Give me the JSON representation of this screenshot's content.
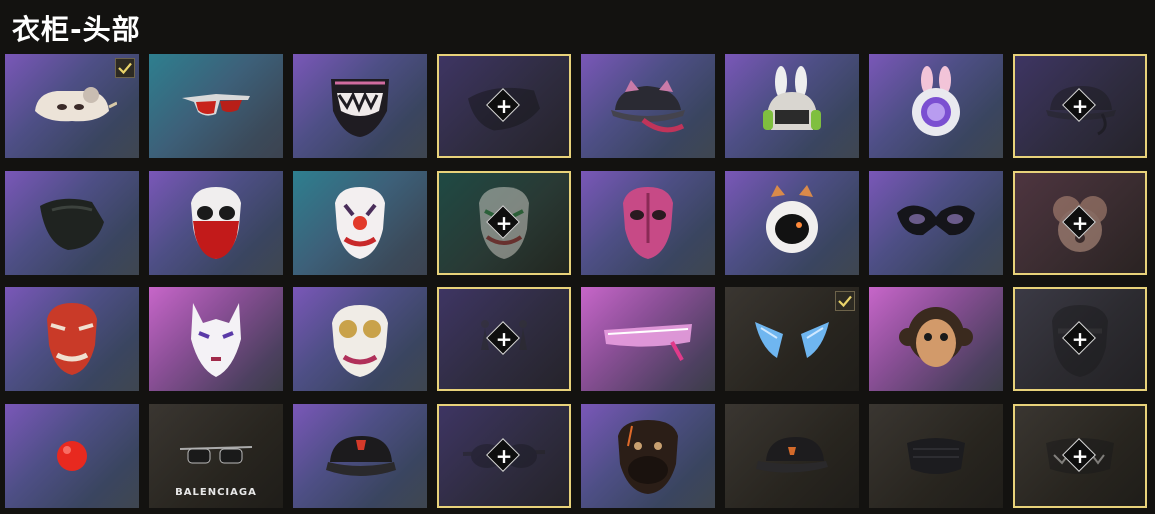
{
  "header": {
    "title": "衣柜-头部"
  },
  "accent_color": "#e8d27a",
  "check_color": "#e9d36a",
  "plus_symbol": "+",
  "items": [
    {
      "icon": "cat-visor-icon",
      "bg": "purple",
      "state": "selected"
    },
    {
      "icon": "sunglasses-icon",
      "bg": "teal",
      "state": "normal"
    },
    {
      "icon": "teeth-mask-icon",
      "bg": "purple",
      "state": "normal"
    },
    {
      "icon": "bandana-icon",
      "bg": "dim-purple",
      "state": "locked"
    },
    {
      "icon": "cat-ear-cap-icon",
      "bg": "purple",
      "state": "normal"
    },
    {
      "icon": "bunny-headphones-icon",
      "bg": "purple",
      "state": "normal"
    },
    {
      "icon": "bunny-astronaut-icon",
      "bg": "purple",
      "state": "normal"
    },
    {
      "icon": "headset-cap-icon",
      "bg": "dim-purple",
      "state": "locked"
    },
    {
      "icon": "face-scarf-icon",
      "bg": "purple",
      "state": "normal"
    },
    {
      "icon": "red-skull-mask-icon",
      "bg": "purple",
      "state": "normal"
    },
    {
      "icon": "clown-mask-icon",
      "bg": "teal",
      "state": "normal"
    },
    {
      "icon": "joker-mask-icon",
      "bg": "dim-teal",
      "state": "locked"
    },
    {
      "icon": "pink-face-mask-icon",
      "bg": "purple",
      "state": "normal"
    },
    {
      "icon": "cat-astronaut-icon",
      "bg": "purple",
      "state": "normal"
    },
    {
      "icon": "masquerade-mask-icon",
      "bg": "purple",
      "state": "normal"
    },
    {
      "icon": "poodle-mask-icon",
      "bg": "dim-rose",
      "state": "locked"
    },
    {
      "icon": "oni-mask-icon",
      "bg": "purple",
      "state": "normal"
    },
    {
      "icon": "kitsune-mask-icon",
      "bg": "pink",
      "state": "normal"
    },
    {
      "icon": "steampunk-mask-icon",
      "bg": "purple",
      "state": "normal"
    },
    {
      "icon": "earrings-icon",
      "bg": "dim-purple",
      "state": "locked"
    },
    {
      "icon": "cyber-visor-icon",
      "bg": "pink",
      "state": "normal"
    },
    {
      "icon": "crystal-ears-icon",
      "bg": "dark",
      "state": "selected"
    },
    {
      "icon": "monkey-mask-icon",
      "bg": "pink",
      "state": "normal"
    },
    {
      "icon": "tactical-mask-icon",
      "bg": "dim-gray",
      "state": "locked"
    },
    {
      "icon": "clown-nose-icon",
      "bg": "purple",
      "state": "normal"
    },
    {
      "icon": "balenciaga-glasses-icon",
      "bg": "dark",
      "state": "normal",
      "brand": "BALENCIAGA"
    },
    {
      "icon": "black-cap-icon",
      "bg": "purple",
      "state": "normal"
    },
    {
      "icon": "goggles-icon",
      "bg": "dim-purple",
      "state": "locked"
    },
    {
      "icon": "bulldog-mask-icon",
      "bg": "purple",
      "state": "normal"
    },
    {
      "icon": "baseball-cap-icon",
      "bg": "dark",
      "state": "normal"
    },
    {
      "icon": "face-mask-icon",
      "bg": "dark",
      "state": "normal"
    },
    {
      "icon": "teeth-facemask-icon",
      "bg": "dark",
      "state": "locked"
    }
  ]
}
